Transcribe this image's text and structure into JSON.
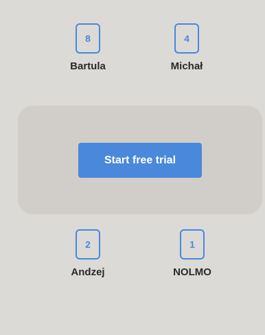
{
  "players": {
    "top_left": {
      "card": "8",
      "name": "Bartula"
    },
    "top_right": {
      "card": "4",
      "name": "Michał"
    },
    "bottom_left": {
      "card": "2",
      "name": "Andzej"
    },
    "bottom_right": {
      "card": "1",
      "name": "NOLMO"
    }
  },
  "table": {
    "cta_label": "Start free trial"
  },
  "colors": {
    "background": "#dcdad7",
    "table": "#d1cdc8",
    "accent": "#4a88db"
  }
}
